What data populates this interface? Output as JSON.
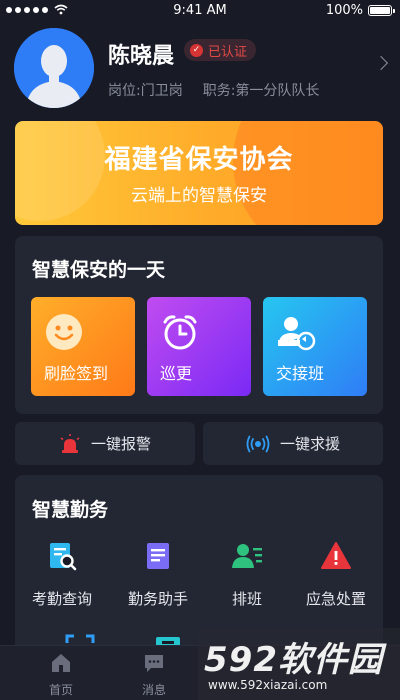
{
  "status_bar": {
    "time": "9:41 AM",
    "battery": "100%"
  },
  "profile": {
    "name": "陈晓晨",
    "badge": "已认证",
    "post": "岗位:门卫岗",
    "role": "职务:第一分队队长"
  },
  "banner": {
    "title": "福建省保安协会",
    "subtitle": "云端上的智慧保安"
  },
  "day_section": {
    "title": "智慧保安的一天",
    "tiles": [
      {
        "label": "刷脸签到",
        "icon": "smiley-face-icon"
      },
      {
        "label": "巡更",
        "icon": "alarm-clock-icon"
      },
      {
        "label": "交接班",
        "icon": "user-exchange-icon"
      }
    ]
  },
  "quick_buttons": [
    {
      "label": "一键报警",
      "icon": "siren-icon"
    },
    {
      "label": "一键求援",
      "icon": "broadcast-icon"
    }
  ],
  "duty_section": {
    "title": "智慧勤务",
    "items": [
      {
        "label": "考勤查询",
        "icon": "document-search-icon"
      },
      {
        "label": "勤务助手",
        "icon": "checklist-icon"
      },
      {
        "label": "排班",
        "icon": "user-list-icon"
      },
      {
        "label": "应急处置",
        "icon": "warning-triangle-icon"
      }
    ]
  },
  "tab_bar": {
    "tabs": [
      {
        "label": "首页",
        "icon": "home-icon"
      },
      {
        "label": "消息",
        "icon": "message-icon"
      },
      {
        "label": "",
        "icon": "tab-icon"
      },
      {
        "label": "",
        "icon": "tab-icon"
      }
    ]
  },
  "watermark": {
    "title": "592软件园",
    "url": "www.592xiazai.com"
  },
  "colors": {
    "background": "#181b26",
    "card": "#232733",
    "accent_orange": "#ffad2a",
    "accent_purple": "#9b3af5",
    "accent_blue": "#2f9cf6",
    "alert_red": "#e04a48"
  }
}
